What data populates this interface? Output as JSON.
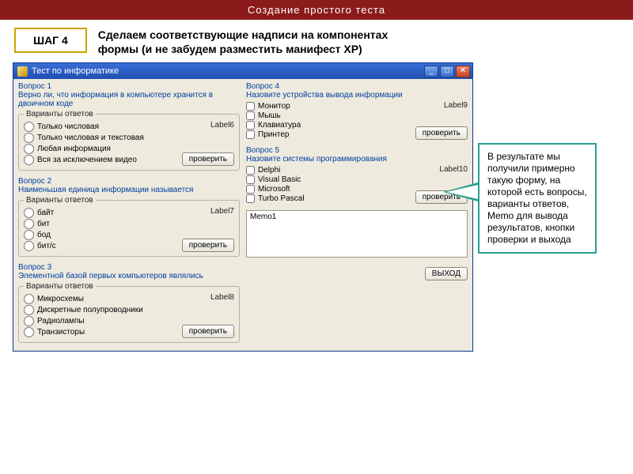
{
  "header": "Создание простого теста",
  "step_label": "ШАГ 4",
  "intro": "Сделаем соответствующие надписи на компонентах формы (и не забудем разместить манифест XP)",
  "window": {
    "title": "Тест по информатике",
    "check_btn": "проверить",
    "exit_btn": "ВЫХОД",
    "variants_legend": "Варианты ответов",
    "questions_left": [
      {
        "num": "Вопрос 1",
        "text": "Верно ли, что информация в компьютере хранится в двоичном коде",
        "label_hint": "Label6",
        "options": [
          "Только числовая",
          "Только числовая и текстовая",
          "Любая информация",
          "Вся за исключением видео"
        ]
      },
      {
        "num": "Вопрос 2",
        "text": "Наименьшая единица информации называется",
        "label_hint": "Label7",
        "options": [
          "байт",
          "бит",
          "бод",
          "бит/с"
        ]
      },
      {
        "num": "Вопрос 3",
        "text": "Элементной базой первых компьютеров являлись",
        "label_hint": "Label8",
        "options": [
          "Микросхемы",
          "Дискретные полупроводники",
          "Радиолампы",
          "Транзисторы"
        ]
      }
    ],
    "questions_right": [
      {
        "num": "Вопрос 4",
        "text": "Назовите устройства вывода информации",
        "label_hint": "Label9",
        "options": [
          "Монитор",
          "Мышь",
          "Клавиатура",
          "Принтер"
        ]
      },
      {
        "num": "Вопрос 5",
        "text": "Назовите системы программирования",
        "label_hint": "Label10",
        "options": [
          "Delphi",
          "Visual Basic",
          "Microsoft",
          "Turbo Pascal"
        ]
      }
    ],
    "memo_text": "Memo1"
  },
  "callout": "   В результате мы получили примерно такую форму, на которой есть вопросы, варианты ответов, Memo для вывода результатов,  кнопки проверки и выхода"
}
